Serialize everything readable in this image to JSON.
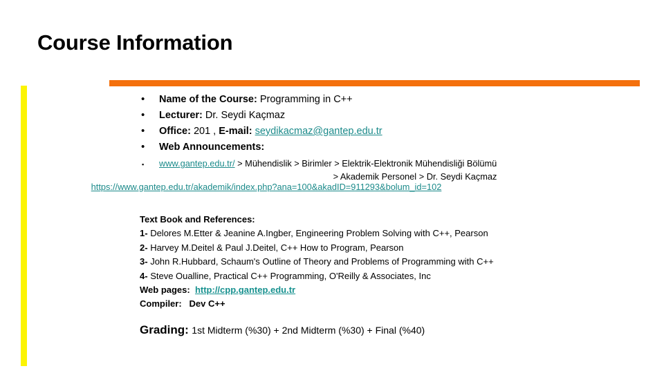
{
  "slide": {
    "title": "Course Information",
    "accent_orange": "#f4700c",
    "accent_yellow": "#fcf403",
    "link_color": "#1b8a8a"
  },
  "bullets": {
    "marker": "•",
    "items": [
      {
        "label": "Name of the Course:",
        "value": "Programming in C++"
      },
      {
        "label": "Lecturer:",
        "value": "Dr. Seydi Kaçmaz"
      },
      {
        "label": "Office:",
        "value": "201 ,",
        "label2": "E-mail:",
        "link": "seydikacmaz@gantep.edu.tr"
      },
      {
        "label": "Web Announcements:",
        "value": ""
      }
    ]
  },
  "path": {
    "marker": "▪",
    "site_link": "www.gantep.edu.tr/",
    "line1_rest": "> Mühendislik > Birimler > Elektrik-Elektronik Mühendisliği Bölümü",
    "line2": "> Akademik Personel > Dr. Seydi Kaçmaz",
    "full_url": "https://www.gantep.edu.tr/akademik/index.php?ana=100&akadID=911293&bolum_id=102"
  },
  "books": {
    "heading": "Text Book and References:",
    "references": [
      {
        "num": "1-",
        "text": "Delores M.Etter & Jeanine A.Ingber, Engineering Problem Solving with C++, Pearson"
      },
      {
        "num": "2-",
        "text": "Harvey M.Deitel & Paul J.Deitel, C++ How to Program, Pearson"
      },
      {
        "num": "3-",
        "text": "John R.Hubbard, Schaum's Outline of Theory and Problems of Programming with C++"
      },
      {
        "num": "4-",
        "text": "Steve Oualline, Practical C++ Programming, O'Reilly & Associates, Inc"
      }
    ],
    "web_pages_label": "Web pages:",
    "web_pages_link": "http://cpp.gantep.edu.tr",
    "compiler_label": "Compiler:",
    "compiler_value": "Dev C++"
  },
  "grading": {
    "label": "Grading:",
    "value": "1st Midterm (%30) + 2nd Midterm (%30) + Final (%40)"
  }
}
